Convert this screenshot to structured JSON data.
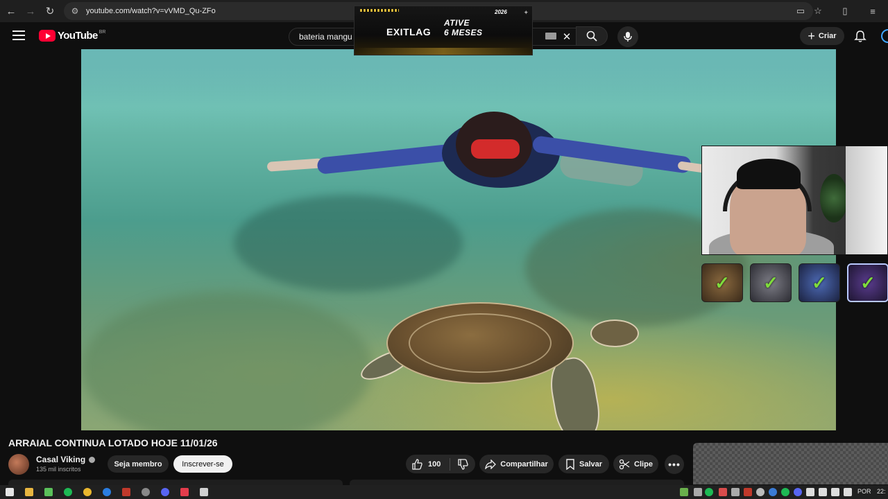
{
  "browser": {
    "url": "youtube.com/watch?v=vVMD_Qu-ZFo"
  },
  "header": {
    "logo_text": "YouTube",
    "country_code": "BR",
    "search_value": "bateria mangu",
    "create_label": "Criar"
  },
  "sponsor": {
    "brand": "EXITLAG",
    "promo_line1": "ATIVE",
    "promo_line2": "6 MESES",
    "year": "2026"
  },
  "video": {
    "title": "ARRAIAL CONTINUA LOTADO HOJE 11/01/26"
  },
  "channel": {
    "name": "Casal Viking",
    "subscribers": "135 mil inscritos"
  },
  "actions": {
    "member_label": "Seja membro",
    "subscribe_label": "Inscrever-se",
    "like_count": "100",
    "share_label": "Compartilhar",
    "save_label": "Salvar",
    "clip_label": "Clipe",
    "more_label": "•••"
  },
  "taskbar": {
    "language": "POR",
    "time": "22:"
  },
  "colors": {
    "brand_red": "#ff0033",
    "background": "#0f0f0f",
    "pill": "#272727",
    "subscribe_bg": "#f1f1f1"
  },
  "icons": {
    "browser": [
      "back-icon",
      "forward-icon",
      "reload-icon",
      "site-info-icon",
      "cast-icon",
      "star-icon",
      "extensions-icon",
      "menu-icon"
    ],
    "header": [
      "hamburger-icon",
      "clear-icon",
      "search-icon",
      "mic-icon",
      "plus-icon",
      "bell-icon"
    ],
    "actions": [
      "thumb-up-icon",
      "thumb-down-icon",
      "share-icon",
      "save-icon",
      "scissors-icon",
      "more-icon"
    ]
  }
}
